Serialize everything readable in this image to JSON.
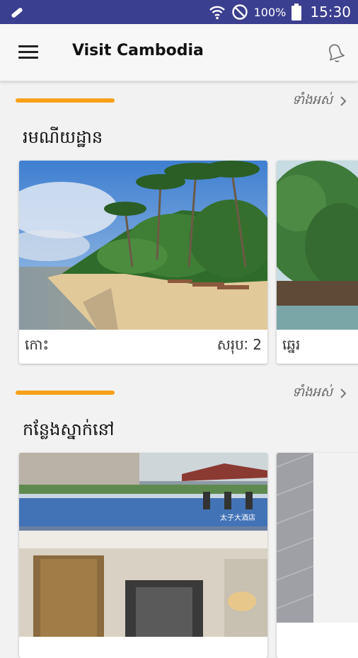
{
  "status_bar": {
    "battery": "100%",
    "time": "15:30",
    "icons": [
      "wrench-icon",
      "wifi-icon",
      "do-not-disturb-icon",
      "battery-icon"
    ]
  },
  "app_bar": {
    "title": "Visit Cambodia",
    "menu_icon": "hamburger-menu-icon",
    "notification_icon": "bell-icon"
  },
  "sections": [
    {
      "heading": "រមណីយដ្ឋាន",
      "see_all": "ទាំងអស់",
      "cards": [
        {
          "label": "កោះ",
          "count": "សរុបៈ 2",
          "image": "tropical beach with palm trees"
        },
        {
          "label": "ឆ្នេរ",
          "count": "",
          "image": "mangrove trees by water"
        }
      ]
    },
    {
      "heading": "កន្លែងស្នាក់នៅ",
      "see_all": "ទាំងអស់",
      "cards": [
        {
          "label": "",
          "count": "",
          "image": "hotel pool and lobby",
          "watermark": "太子大酒店"
        },
        {
          "label": "",
          "count": "",
          "image": "grey hotel facade"
        }
      ]
    }
  ],
  "colors": {
    "status_bar": "#3b3f8f",
    "accent": "#f7a11a",
    "background": "#f2f2f2"
  }
}
